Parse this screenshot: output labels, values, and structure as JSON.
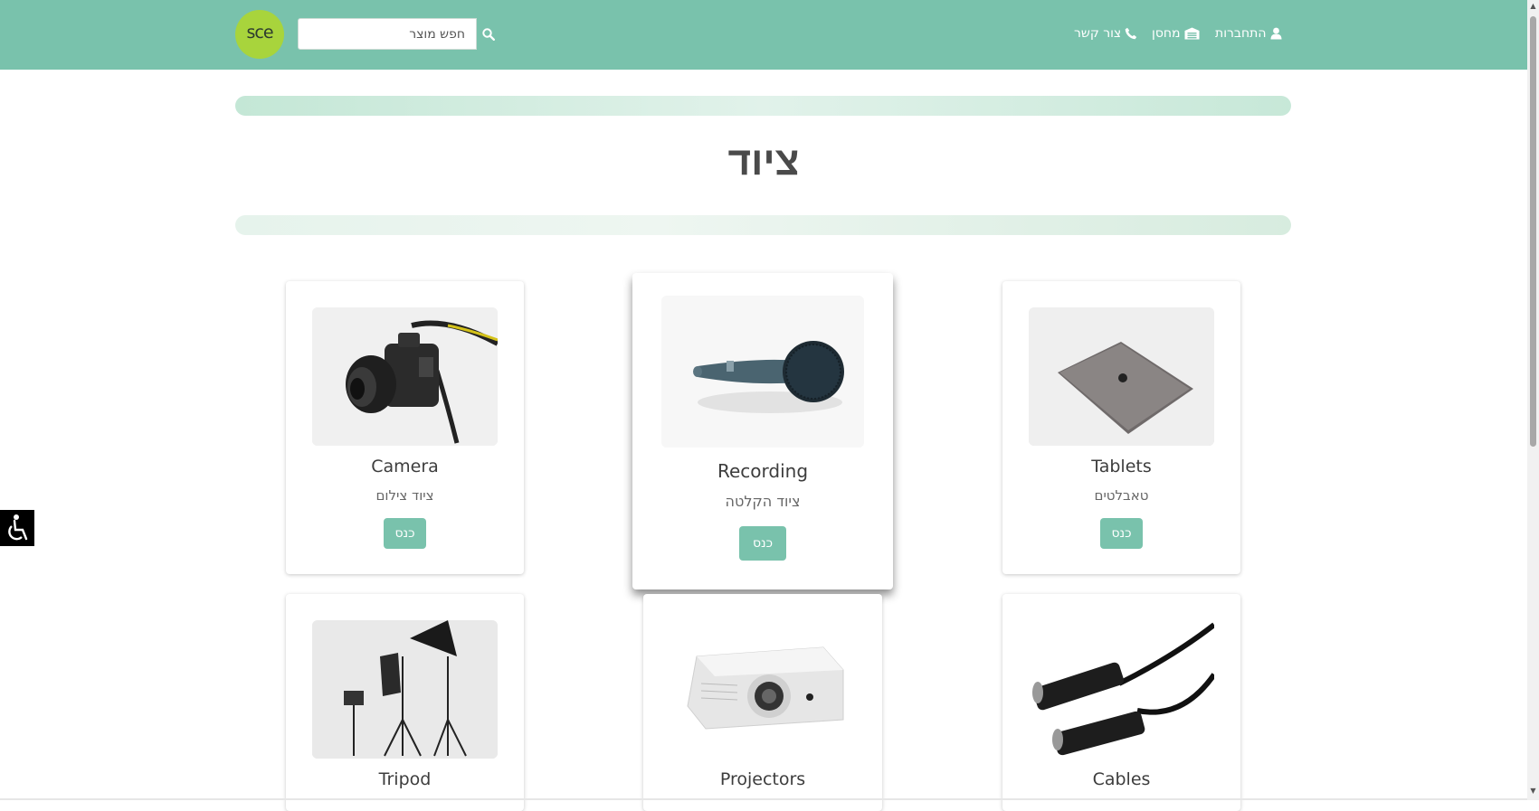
{
  "header": {
    "logo_text": "sce",
    "search": {
      "placeholder": "חפש מוצר"
    },
    "nav": [
      {
        "label": "התחברות",
        "icon": "user-icon"
      },
      {
        "label": "מחסן",
        "icon": "warehouse-icon"
      },
      {
        "label": "צור קשר",
        "icon": "phone-icon"
      }
    ]
  },
  "page": {
    "title": "ציוד"
  },
  "cards": [
    {
      "title": "Camera",
      "subtitle": "ציוד צילום",
      "button": "כנס",
      "image": "camera-image"
    },
    {
      "title": "Recording",
      "subtitle": "ציוד הקלטה",
      "button": "כנס",
      "image": "microphone-image"
    },
    {
      "title": "Tablets",
      "subtitle": "טאבלטים",
      "button": "כנס",
      "image": "tablet-image"
    },
    {
      "title": "Tripod",
      "image": "studio-tripod-image"
    },
    {
      "title": "Projectors",
      "image": "projector-image"
    },
    {
      "title": "Cables",
      "image": "xlr-cables-image"
    }
  ],
  "colors": {
    "header_bg": "#79c2ac",
    "logo_bg": "#a8d43c",
    "button_bg": "#79c2ac"
  }
}
